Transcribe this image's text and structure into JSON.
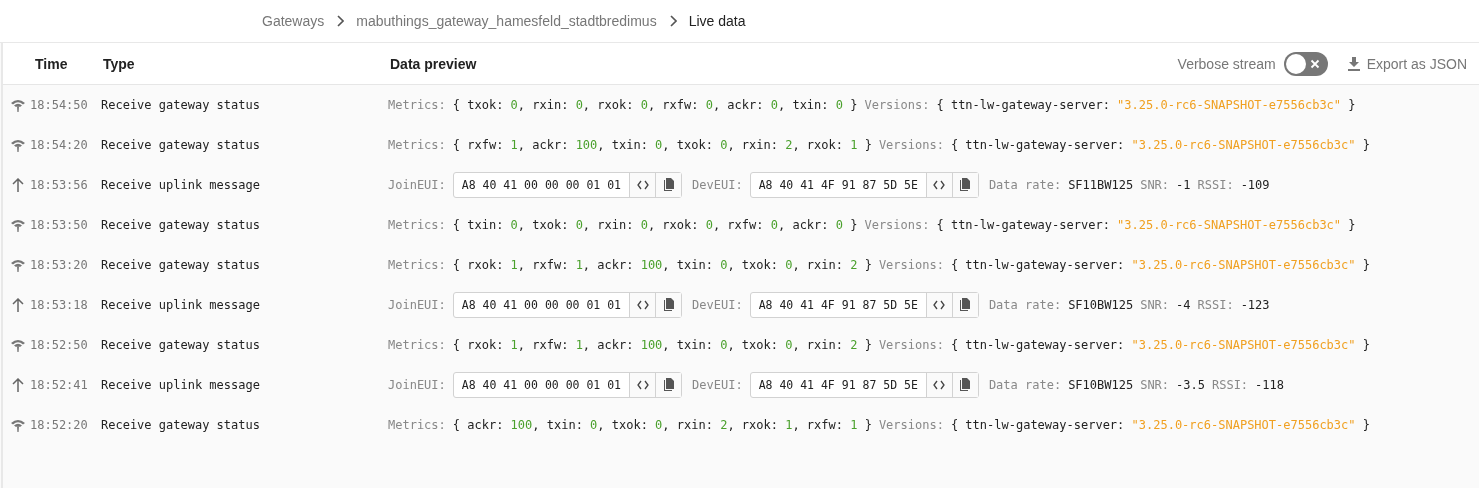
{
  "breadcrumb": [
    {
      "label": "Gateways",
      "current": false
    },
    {
      "label": "mabuthings_gateway_hamesfeld_stadtbredimus",
      "current": false
    },
    {
      "label": "Live data",
      "current": true
    }
  ],
  "columns": [
    "Time",
    "Type",
    "Data preview"
  ],
  "verbose_stream": {
    "label": "Verbose stream",
    "on": false
  },
  "export_button": "Export as JSON",
  "rows": [
    {
      "kind": "status",
      "time": "18:54:50",
      "type": "Receive gateway status",
      "preview": [
        {
          "kind": "label",
          "text": "Metrics:"
        },
        {
          "kind": "plain",
          "text": "{ txok: "
        },
        {
          "kind": "num",
          "text": "0"
        },
        {
          "kind": "plain",
          "text": ", rxin: "
        },
        {
          "kind": "num",
          "text": "0"
        },
        {
          "kind": "plain",
          "text": ", rxok: "
        },
        {
          "kind": "num",
          "text": "0"
        },
        {
          "kind": "plain",
          "text": ", rxfw: "
        },
        {
          "kind": "num",
          "text": "0"
        },
        {
          "kind": "plain",
          "text": ", ackr: "
        },
        {
          "kind": "num",
          "text": "0"
        },
        {
          "kind": "plain",
          "text": ", txin: "
        },
        {
          "kind": "num",
          "text": "0"
        },
        {
          "kind": "plain",
          "text": " }"
        },
        {
          "kind": "label",
          "text": "Versions:"
        },
        {
          "kind": "plain",
          "text": "{ ttn-lw-gateway-server: "
        },
        {
          "kind": "str",
          "text": "\"3.25.0-rc6-SNAPSHOT-e7556cb3c\""
        },
        {
          "kind": "plain",
          "text": " }"
        }
      ]
    },
    {
      "kind": "status",
      "time": "18:54:20",
      "type": "Receive gateway status",
      "preview": [
        {
          "kind": "label",
          "text": "Metrics:"
        },
        {
          "kind": "plain",
          "text": "{ rxfw: "
        },
        {
          "kind": "num",
          "text": "1"
        },
        {
          "kind": "plain",
          "text": ", ackr: "
        },
        {
          "kind": "num",
          "text": "100"
        },
        {
          "kind": "plain",
          "text": ", txin: "
        },
        {
          "kind": "num",
          "text": "0"
        },
        {
          "kind": "plain",
          "text": ", txok: "
        },
        {
          "kind": "num",
          "text": "0"
        },
        {
          "kind": "plain",
          "text": ", rxin: "
        },
        {
          "kind": "num",
          "text": "2"
        },
        {
          "kind": "plain",
          "text": ", rxok: "
        },
        {
          "kind": "num",
          "text": "1"
        },
        {
          "kind": "plain",
          "text": " }"
        },
        {
          "kind": "label",
          "text": "Versions:"
        },
        {
          "kind": "plain",
          "text": "{ ttn-lw-gateway-server: "
        },
        {
          "kind": "str",
          "text": "\"3.25.0-rc6-SNAPSHOT-e7556cb3c\""
        },
        {
          "kind": "plain",
          "text": " }"
        }
      ]
    },
    {
      "kind": "uplink",
      "time": "18:53:56",
      "type": "Receive uplink message",
      "join_label": "JoinEUI:",
      "join_eui": "A8 40 41 00 00 00 01 01",
      "dev_label": "DevEUI:",
      "dev_eui": "A8 40 41 4F 91 87 5D 5E",
      "details": [
        {
          "kind": "label",
          "text": "Data rate:"
        },
        {
          "kind": "plain",
          "text": "SF11BW125"
        },
        {
          "kind": "label",
          "text": "SNR:"
        },
        {
          "kind": "plain",
          "text": "-1"
        },
        {
          "kind": "label",
          "text": "RSSI:"
        },
        {
          "kind": "plain",
          "text": "-109"
        }
      ]
    },
    {
      "kind": "status",
      "time": "18:53:50",
      "type": "Receive gateway status",
      "preview": [
        {
          "kind": "label",
          "text": "Metrics:"
        },
        {
          "kind": "plain",
          "text": "{ txin: "
        },
        {
          "kind": "num",
          "text": "0"
        },
        {
          "kind": "plain",
          "text": ", txok: "
        },
        {
          "kind": "num",
          "text": "0"
        },
        {
          "kind": "plain",
          "text": ", rxin: "
        },
        {
          "kind": "num",
          "text": "0"
        },
        {
          "kind": "plain",
          "text": ", rxok: "
        },
        {
          "kind": "num",
          "text": "0"
        },
        {
          "kind": "plain",
          "text": ", rxfw: "
        },
        {
          "kind": "num",
          "text": "0"
        },
        {
          "kind": "plain",
          "text": ", ackr: "
        },
        {
          "kind": "num",
          "text": "0"
        },
        {
          "kind": "plain",
          "text": " }"
        },
        {
          "kind": "label",
          "text": "Versions:"
        },
        {
          "kind": "plain",
          "text": "{ ttn-lw-gateway-server: "
        },
        {
          "kind": "str",
          "text": "\"3.25.0-rc6-SNAPSHOT-e7556cb3c\""
        },
        {
          "kind": "plain",
          "text": " }"
        }
      ]
    },
    {
      "kind": "status",
      "time": "18:53:20",
      "type": "Receive gateway status",
      "preview": [
        {
          "kind": "label",
          "text": "Metrics:"
        },
        {
          "kind": "plain",
          "text": "{ rxok: "
        },
        {
          "kind": "num",
          "text": "1"
        },
        {
          "kind": "plain",
          "text": ", rxfw: "
        },
        {
          "kind": "num",
          "text": "1"
        },
        {
          "kind": "plain",
          "text": ", ackr: "
        },
        {
          "kind": "num",
          "text": "100"
        },
        {
          "kind": "plain",
          "text": ", txin: "
        },
        {
          "kind": "num",
          "text": "0"
        },
        {
          "kind": "plain",
          "text": ", txok: "
        },
        {
          "kind": "num",
          "text": "0"
        },
        {
          "kind": "plain",
          "text": ", rxin: "
        },
        {
          "kind": "num",
          "text": "2"
        },
        {
          "kind": "plain",
          "text": " }"
        },
        {
          "kind": "label",
          "text": "Versions:"
        },
        {
          "kind": "plain",
          "text": "{ ttn-lw-gateway-server: "
        },
        {
          "kind": "str",
          "text": "\"3.25.0-rc6-SNAPSHOT-e7556cb3c\""
        },
        {
          "kind": "plain",
          "text": " }"
        }
      ]
    },
    {
      "kind": "uplink",
      "time": "18:53:18",
      "type": "Receive uplink message",
      "join_label": "JoinEUI:",
      "join_eui": "A8 40 41 00 00 00 01 01",
      "dev_label": "DevEUI:",
      "dev_eui": "A8 40 41 4F 91 87 5D 5E",
      "details": [
        {
          "kind": "label",
          "text": "Data rate:"
        },
        {
          "kind": "plain",
          "text": "SF10BW125"
        },
        {
          "kind": "label",
          "text": "SNR:"
        },
        {
          "kind": "plain",
          "text": "-4"
        },
        {
          "kind": "label",
          "text": "RSSI:"
        },
        {
          "kind": "plain",
          "text": "-123"
        }
      ]
    },
    {
      "kind": "status",
      "time": "18:52:50",
      "type": "Receive gateway status",
      "preview": [
        {
          "kind": "label",
          "text": "Metrics:"
        },
        {
          "kind": "plain",
          "text": "{ rxok: "
        },
        {
          "kind": "num",
          "text": "1"
        },
        {
          "kind": "plain",
          "text": ", rxfw: "
        },
        {
          "kind": "num",
          "text": "1"
        },
        {
          "kind": "plain",
          "text": ", ackr: "
        },
        {
          "kind": "num",
          "text": "100"
        },
        {
          "kind": "plain",
          "text": ", txin: "
        },
        {
          "kind": "num",
          "text": "0"
        },
        {
          "kind": "plain",
          "text": ", txok: "
        },
        {
          "kind": "num",
          "text": "0"
        },
        {
          "kind": "plain",
          "text": ", rxin: "
        },
        {
          "kind": "num",
          "text": "2"
        },
        {
          "kind": "plain",
          "text": " }"
        },
        {
          "kind": "label",
          "text": "Versions:"
        },
        {
          "kind": "plain",
          "text": "{ ttn-lw-gateway-server: "
        },
        {
          "kind": "str",
          "text": "\"3.25.0-rc6-SNAPSHOT-e7556cb3c\""
        },
        {
          "kind": "plain",
          "text": " }"
        }
      ]
    },
    {
      "kind": "uplink",
      "time": "18:52:41",
      "type": "Receive uplink message",
      "join_label": "JoinEUI:",
      "join_eui": "A8 40 41 00 00 00 01 01",
      "dev_label": "DevEUI:",
      "dev_eui": "A8 40 41 4F 91 87 5D 5E",
      "details": [
        {
          "kind": "label",
          "text": "Data rate:"
        },
        {
          "kind": "plain",
          "text": "SF10BW125"
        },
        {
          "kind": "label",
          "text": "SNR:"
        },
        {
          "kind": "plain",
          "text": "-3.5"
        },
        {
          "kind": "label",
          "text": "RSSI:"
        },
        {
          "kind": "plain",
          "text": "-118"
        }
      ]
    },
    {
      "kind": "status",
      "time": "18:52:20",
      "type": "Receive gateway status",
      "preview": [
        {
          "kind": "label",
          "text": "Metrics:"
        },
        {
          "kind": "plain",
          "text": "{ ackr: "
        },
        {
          "kind": "num",
          "text": "100"
        },
        {
          "kind": "plain",
          "text": ", txin: "
        },
        {
          "kind": "num",
          "text": "0"
        },
        {
          "kind": "plain",
          "text": ", txok: "
        },
        {
          "kind": "num",
          "text": "0"
        },
        {
          "kind": "plain",
          "text": ", rxin: "
        },
        {
          "kind": "num",
          "text": "2"
        },
        {
          "kind": "plain",
          "text": ", rxok: "
        },
        {
          "kind": "num",
          "text": "1"
        },
        {
          "kind": "plain",
          "text": ", rxfw: "
        },
        {
          "kind": "num",
          "text": "1"
        },
        {
          "kind": "plain",
          "text": " }"
        },
        {
          "kind": "label",
          "text": "Versions:"
        },
        {
          "kind": "plain",
          "text": "{ ttn-lw-gateway-server: "
        },
        {
          "kind": "str",
          "text": "\"3.25.0-rc6-SNAPSHOT-e7556cb3c\""
        },
        {
          "kind": "plain",
          "text": " }"
        }
      ]
    }
  ]
}
